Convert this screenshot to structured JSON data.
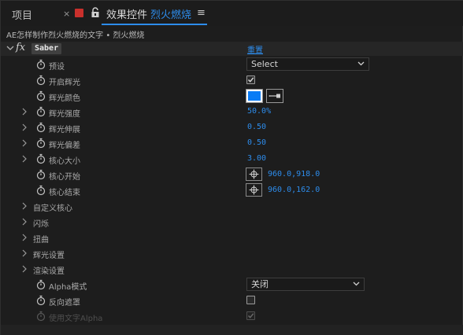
{
  "tabs": {
    "project": "项目",
    "effects_prefix": "效果控件",
    "effects_layer": "烈火燃烧"
  },
  "breadcrumb": "AE怎样制作烈火燃烧的文字 • 烈火燃烧",
  "effect": {
    "badge": "fx",
    "name": "Saber",
    "reset_label": "重置"
  },
  "properties": {
    "preset": {
      "label": "预设",
      "value": "Select"
    },
    "enable_glow": {
      "label": "开启辉光",
      "checked": true
    },
    "glow_color": {
      "label": "辉光颜色",
      "color": "#0a7cf5"
    },
    "glow_intensity": {
      "label": "辉光强度",
      "value": "50.0%"
    },
    "glow_spread": {
      "label": "辉光伸展",
      "value": "0.50"
    },
    "glow_bias": {
      "label": "辉光偏差",
      "value": "0.50"
    },
    "core_size": {
      "label": "核心大小",
      "value": "3.00"
    },
    "core_start": {
      "label": "核心开始",
      "value": "960.0,918.0"
    },
    "core_end": {
      "label": "核心结束",
      "value": "960.0,162.0"
    }
  },
  "groups": {
    "custom_core": "自定义核心",
    "flicker": "闪烁",
    "distortion": "扭曲",
    "glow_settings": "辉光设置",
    "render_settings": "渲染设置"
  },
  "render": {
    "alpha_mode": {
      "label": "Alpha模式",
      "value": "关闭"
    },
    "invert_mask": {
      "label": "反向遮罩",
      "checked": false
    },
    "use_text_alpha": {
      "label": "使用文字Alpha",
      "checked": true
    }
  },
  "colors": {
    "accent": "#2d8ceb",
    "background": "#1d1d1d",
    "tab_red": "#c9302c"
  }
}
